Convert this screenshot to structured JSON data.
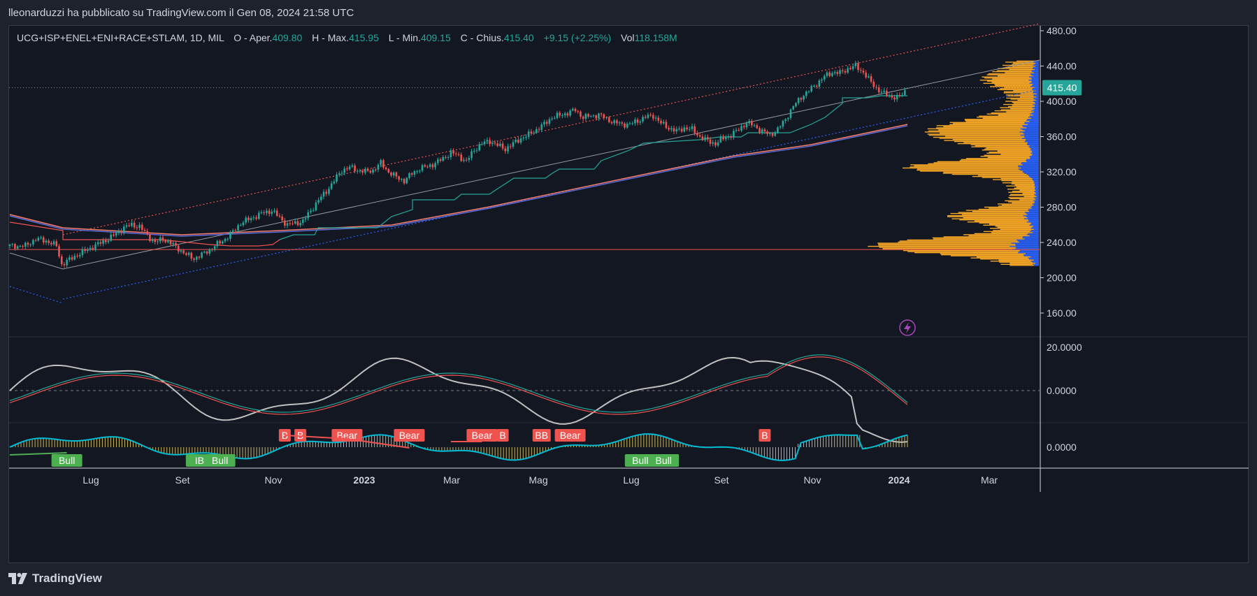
{
  "caption": "lleonarduzzi ha pubblicato su TradingView.com il Gen 08, 2024 21:58 UTC",
  "legend": {
    "symbol": "UCG+ISP+ENEL+ENI+RACE+STLAM, 1D, MIL",
    "open_label": "O - Aper.",
    "open": "409.80",
    "high_label": "H - Max.",
    "high": "415.95",
    "low_label": "L - Min.",
    "low": "409.15",
    "close_label": "C - Chius.",
    "close": "415.40",
    "change": "+9.15 (+2.25%)",
    "vol_label": "Vol",
    "vol": "118.158M"
  },
  "footer": {
    "brand": "TradingView"
  },
  "colors": {
    "up": "#26a69a",
    "down": "#ef5350",
    "volume_profile_up": "#2962ff",
    "volume_profile_down": "#f9a825",
    "bg": "#131722"
  },
  "chart_data": {
    "type": "candlestick",
    "symbol": "UCG+ISP+ENEL+ENI+RACE+STLAM",
    "interval": "1D",
    "exchange": "MIL",
    "last_price": "415.40",
    "price_axis": {
      "ticks": [
        "480.00",
        "440.00",
        "400.00",
        "360.00",
        "320.00",
        "280.00",
        "240.00",
        "200.00",
        "160.00"
      ],
      "range": [
        160,
        480
      ]
    },
    "oscillator_axis": {
      "ticks": [
        "20.0000",
        "0.0000"
      ]
    },
    "histogram_axis": {
      "ticks": [
        "0.0000"
      ]
    },
    "x_ticks": [
      {
        "label": "Lug",
        "bold": false
      },
      {
        "label": "Set",
        "bold": false
      },
      {
        "label": "Nov",
        "bold": false
      },
      {
        "label": "2023",
        "bold": true
      },
      {
        "label": "Mar",
        "bold": false
      },
      {
        "label": "Mag",
        "bold": false
      },
      {
        "label": "Lug",
        "bold": false
      },
      {
        "label": "Set",
        "bold": false
      },
      {
        "label": "Nov",
        "bold": false
      },
      {
        "label": "2024",
        "bold": true
      },
      {
        "label": "Mar",
        "bold": false
      }
    ],
    "price_path": [
      [
        0,
        236
      ],
      [
        6,
        236
      ],
      [
        10,
        244
      ],
      [
        14,
        242
      ],
      [
        18,
        236
      ],
      [
        20,
        215
      ],
      [
        26,
        226
      ],
      [
        30,
        232
      ],
      [
        34,
        238
      ],
      [
        38,
        244
      ],
      [
        41,
        250
      ],
      [
        44,
        257
      ],
      [
        47,
        260
      ],
      [
        50,
        258
      ],
      [
        53,
        248
      ],
      [
        56,
        240
      ],
      [
        59,
        244
      ],
      [
        62,
        239
      ],
      [
        65,
        233
      ],
      [
        68,
        226
      ],
      [
        71,
        222
      ],
      [
        74,
        226
      ],
      [
        77,
        232
      ],
      [
        80,
        238
      ],
      [
        83,
        244
      ],
      [
        86,
        252
      ],
      [
        89,
        262
      ],
      [
        92,
        266
      ],
      [
        95,
        270
      ],
      [
        98,
        274
      ],
      [
        101,
        276
      ],
      [
        104,
        268
      ],
      [
        107,
        260
      ],
      [
        110,
        262
      ],
      [
        113,
        264
      ],
      [
        116,
        276
      ],
      [
        119,
        288
      ],
      [
        122,
        298
      ],
      [
        125,
        310
      ],
      [
        128,
        322
      ],
      [
        131,
        325
      ],
      [
        134,
        322
      ],
      [
        137,
        320
      ],
      [
        140,
        322
      ],
      [
        143,
        330
      ],
      [
        146,
        320
      ],
      [
        149,
        314
      ],
      [
        152,
        310
      ],
      [
        155,
        318
      ],
      [
        158,
        324
      ],
      [
        161,
        326
      ],
      [
        164,
        330
      ],
      [
        167,
        335
      ],
      [
        170,
        342
      ],
      [
        173,
        338
      ],
      [
        176,
        332
      ],
      [
        179,
        345
      ],
      [
        182,
        352
      ],
      [
        185,
        355
      ],
      [
        188,
        350
      ],
      [
        191,
        346
      ],
      [
        194,
        352
      ],
      [
        197,
        358
      ],
      [
        200,
        362
      ],
      [
        203,
        368
      ],
      [
        206,
        374
      ],
      [
        209,
        382
      ],
      [
        212,
        384
      ],
      [
        215,
        387
      ],
      [
        218,
        390
      ],
      [
        221,
        382
      ],
      [
        224,
        383
      ],
      [
        227,
        385
      ],
      [
        230,
        380
      ],
      [
        233,
        376
      ],
      [
        236,
        374
      ],
      [
        239,
        374
      ],
      [
        242,
        378
      ],
      [
        245,
        382
      ],
      [
        248,
        384
      ],
      [
        251,
        375
      ],
      [
        254,
        370
      ],
      [
        257,
        366
      ],
      [
        260,
        370
      ],
      [
        263,
        368
      ],
      [
        266,
        360
      ],
      [
        269,
        355
      ],
      [
        272,
        352
      ],
      [
        275,
        358
      ],
      [
        278,
        362
      ],
      [
        281,
        368
      ],
      [
        284,
        376
      ],
      [
        287,
        372
      ],
      [
        290,
        366
      ],
      [
        293,
        362
      ],
      [
        296,
        368
      ],
      [
        299,
        380
      ],
      [
        302,
        394
      ],
      [
        305,
        405
      ],
      [
        308,
        412
      ],
      [
        311,
        420
      ],
      [
        314,
        428
      ],
      [
        317,
        433
      ],
      [
        320,
        432
      ],
      [
        323,
        437
      ],
      [
        326,
        440
      ],
      [
        329,
        433
      ],
      [
        331,
        425
      ],
      [
        333,
        418
      ],
      [
        336,
        410
      ],
      [
        339,
        406
      ],
      [
        342,
        404
      ],
      [
        344,
        408
      ],
      [
        346,
        415.4
      ]
    ],
    "note": "price_path values are [bar_index, approximate close]; bar_index spans the visible history Jun-2022 to Jan-2024",
    "volume_profile": true,
    "annotations": [
      "B",
      "B",
      "Bear",
      "Bear",
      "Bear",
      "B",
      "BB",
      "Bear",
      "B",
      "Bull",
      "Bull",
      "Bull",
      "Bull",
      "Bull"
    ],
    "signal_labels": [
      {
        "text": "Bull",
        "kind": "bull",
        "bar": 22
      },
      {
        "text": "IBull",
        "kind": "bull",
        "bar": 75
      },
      {
        "text": "Bull",
        "kind": "bull",
        "bar": 81
      },
      {
        "text": "B",
        "kind": "bear",
        "bar": 106
      },
      {
        "text": "B",
        "kind": "bear",
        "bar": 112
      },
      {
        "text": "Bear",
        "kind": "bear",
        "bar": 130
      },
      {
        "text": "Bear",
        "kind": "bear",
        "bar": 154
      },
      {
        "text": "Bear",
        "kind": "bear",
        "bar": 182
      },
      {
        "text": "B",
        "kind": "bear",
        "bar": 190
      },
      {
        "text": "BB",
        "kind": "bear",
        "bar": 205
      },
      {
        "text": "Bear",
        "kind": "bear",
        "bar": 216
      },
      {
        "text": "Bull",
        "kind": "bull",
        "bar": 243
      },
      {
        "text": "Bull",
        "kind": "bull",
        "bar": 252
      },
      {
        "text": "B",
        "kind": "bear",
        "bar": 291
      }
    ]
  }
}
